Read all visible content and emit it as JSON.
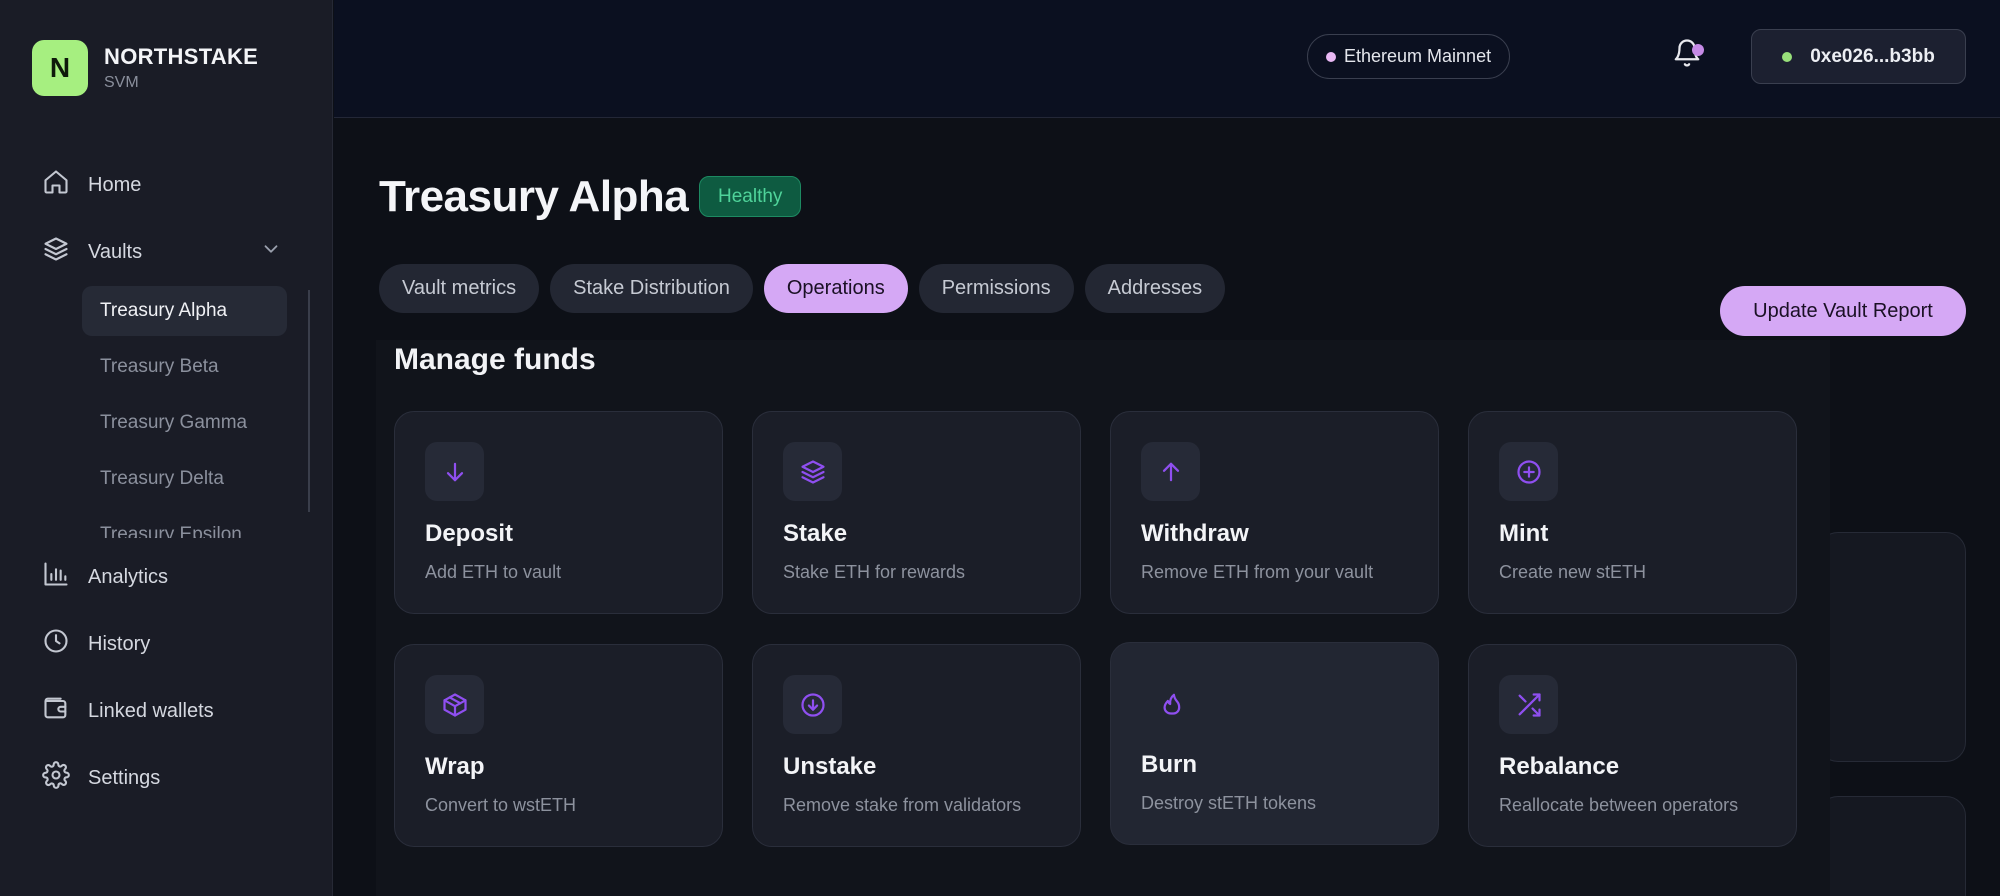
{
  "brand": {
    "logo_letter": "N",
    "name": "NORTHSTAKE",
    "subtitle": "SVM",
    "logo_color": "#a6ef80"
  },
  "sidebar": {
    "items": [
      {
        "label": "Home",
        "icon": "home-icon"
      },
      {
        "label": "Vaults",
        "icon": "layers-icon"
      },
      {
        "label": "Analytics",
        "icon": "bar-chart-icon"
      },
      {
        "label": "History",
        "icon": "clock-icon"
      },
      {
        "label": "Linked wallets",
        "icon": "wallet-icon"
      },
      {
        "label": "Settings",
        "icon": "gear-icon"
      }
    ],
    "vaults": [
      "Treasury Alpha",
      "Treasury Beta",
      "Treasury Gamma",
      "Treasury Delta",
      "Treasury Epsilon"
    ],
    "active_vault": "Treasury Alpha"
  },
  "header": {
    "network": "Ethereum Mainnet",
    "wallet": "0xe026...b3bb",
    "wallet_status_color": "#98e07a",
    "notification_badge_color": "#c58ae6"
  },
  "main": {
    "title": "Treasury Alpha",
    "status": "Healthy",
    "tabs": [
      "Vault metrics",
      "Stake Distribution",
      "Operations",
      "Permissions",
      "Addresses"
    ],
    "active_tab": "Operations",
    "update_button": "Update Vault Report",
    "section_title": "Manage funds",
    "operations": [
      {
        "title": "Deposit",
        "desc": "Add ETH to vault",
        "icon": "arrow-down-icon"
      },
      {
        "title": "Stake",
        "desc": "Stake ETH for rewards",
        "icon": "layers-icon"
      },
      {
        "title": "Withdraw",
        "desc": "Remove ETH from your vault",
        "icon": "arrow-up-icon"
      },
      {
        "title": "Mint",
        "desc": "Create new stETH",
        "icon": "plus-circle-icon"
      },
      {
        "title": "Wrap",
        "desc": "Convert to wstETH",
        "icon": "box-icon"
      },
      {
        "title": "Unstake",
        "desc": "Remove stake from validators",
        "icon": "arrow-down-circle-icon"
      },
      {
        "title": "Burn",
        "desc": "Destroy stETH tokens",
        "icon": "flame-icon"
      },
      {
        "title": "Rebalance",
        "desc": "Reallocate between operators",
        "icon": "shuffle-icon"
      }
    ]
  },
  "colors": {
    "accent": "#d5a8f5",
    "icon_accent": "#8f4ff0",
    "healthy": "#4fd39a"
  }
}
